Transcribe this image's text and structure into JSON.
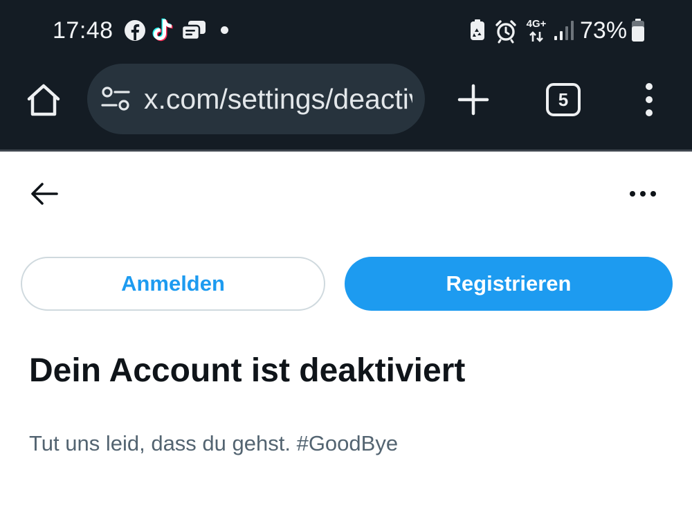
{
  "status_bar": {
    "time": "17:48",
    "notification_icons": [
      "facebook-icon",
      "tiktok-icon",
      "chat-app-icon"
    ],
    "network_label_top": "4G+",
    "battery_percent": "73%"
  },
  "browser": {
    "url": "x.com/settings/deactivate",
    "tab_count": "5"
  },
  "page": {
    "login_button": "Anmelden",
    "register_button": "Registrieren",
    "title": "Dein Account ist deaktiviert",
    "subtitle": "Tut uns leid, dass du gehst. #GoodBye"
  },
  "colors": {
    "chrome_background": "#141c24",
    "urlbar_background": "#27333d",
    "accent": "#1d9bf0",
    "title_text": "#0f1419",
    "secondary_text": "#536471",
    "outline_border": "#cfd9de"
  }
}
